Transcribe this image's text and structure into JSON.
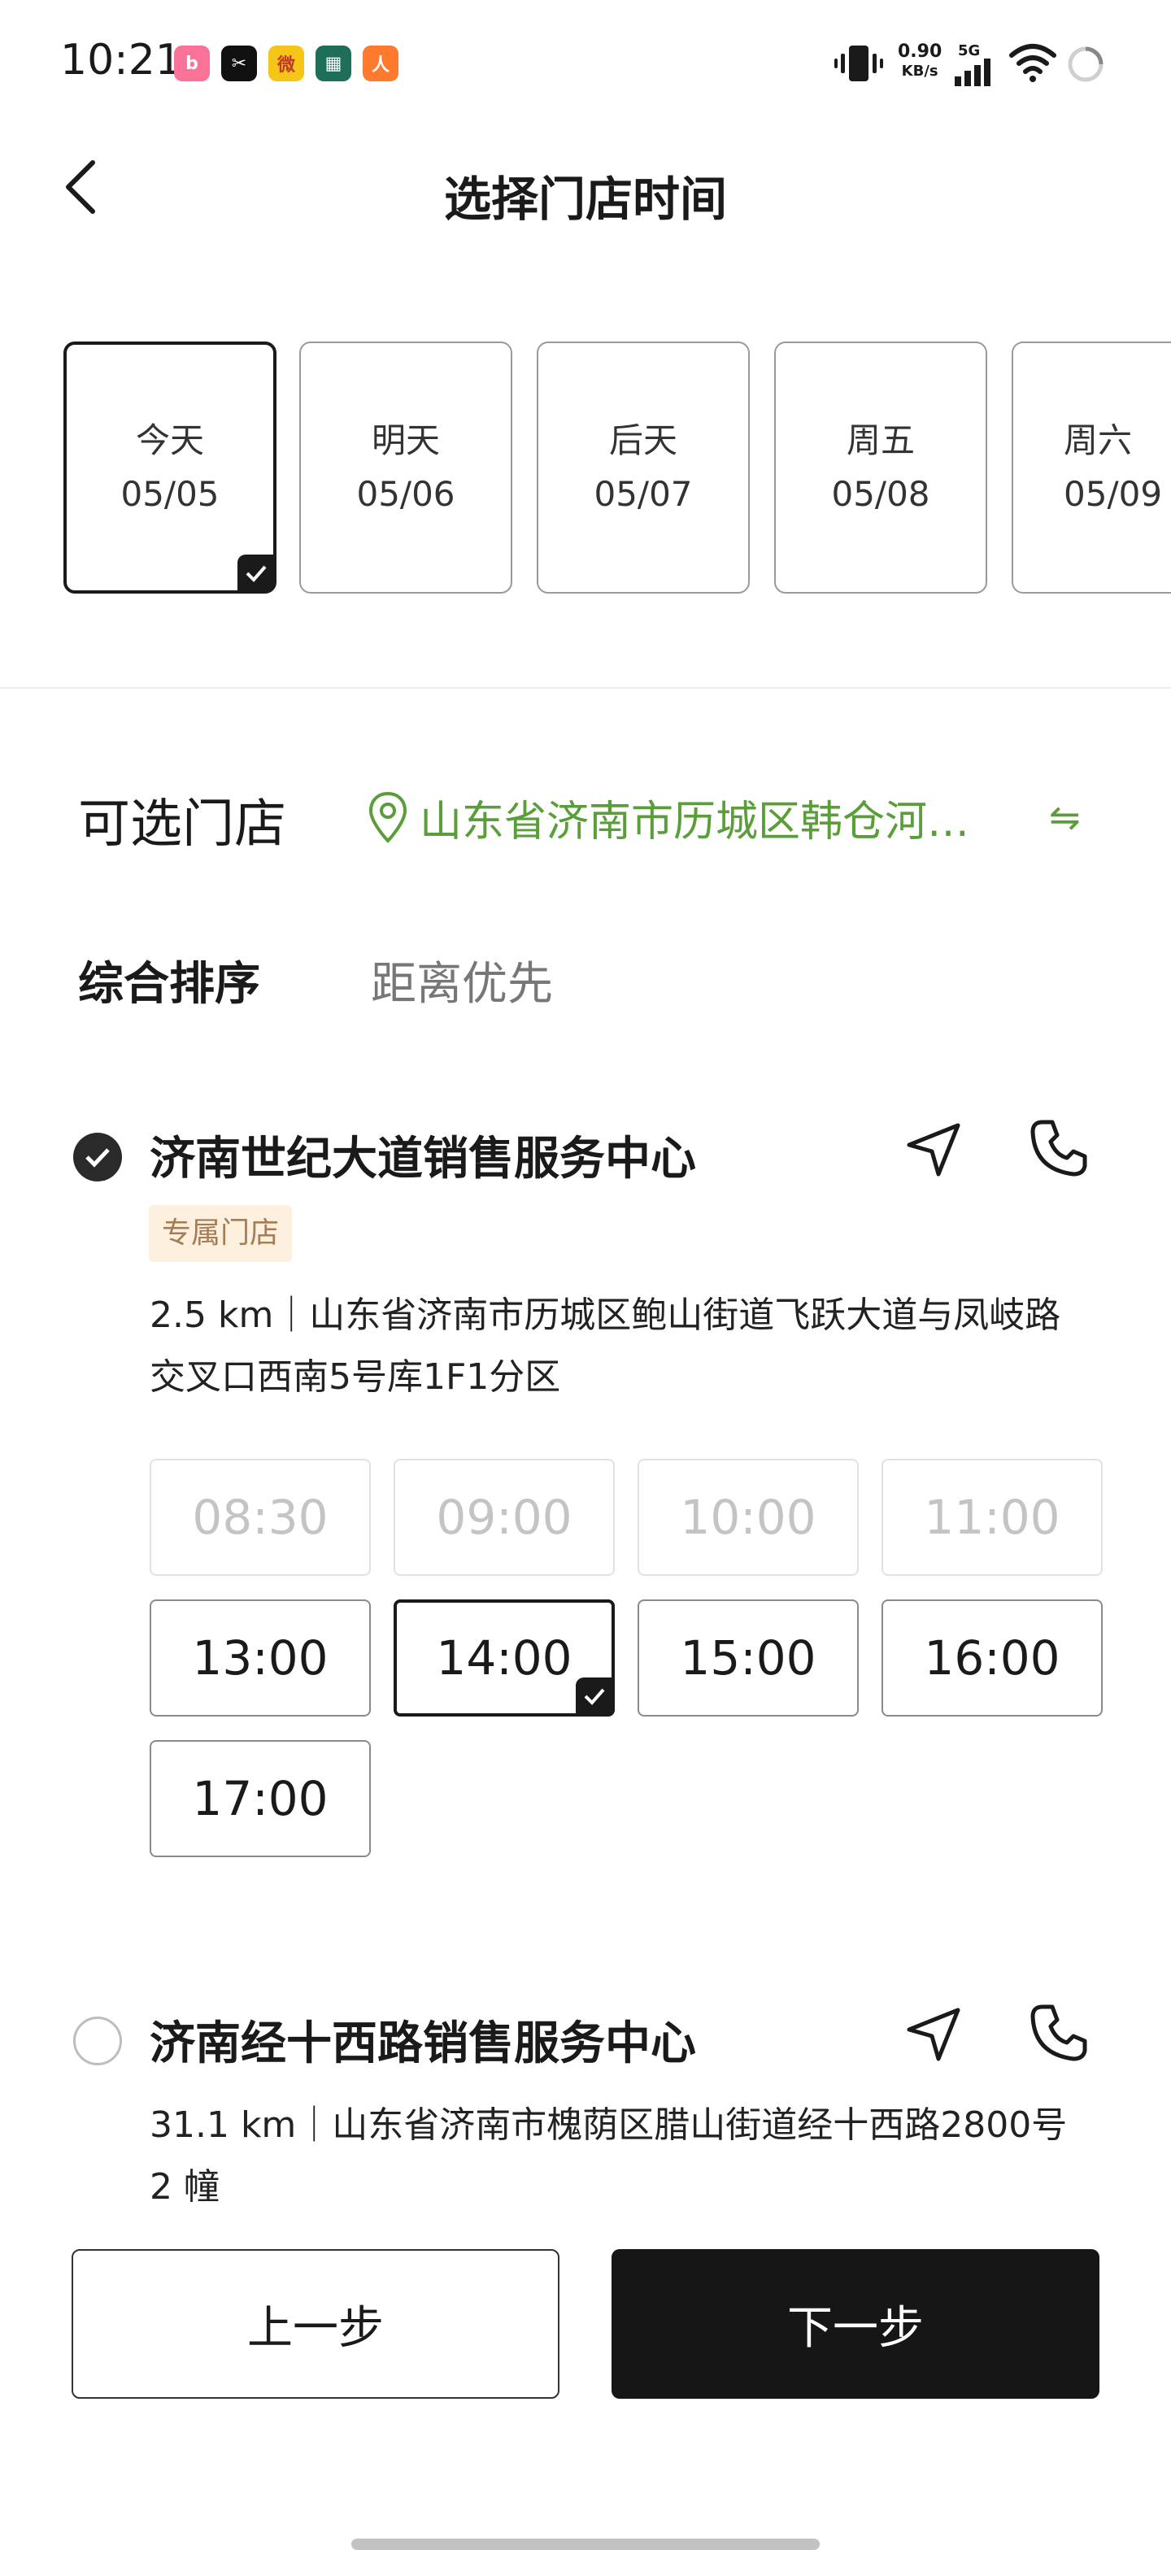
{
  "status_bar": {
    "time": "10:21",
    "apps": [
      {
        "icon": "bilibili-icon",
        "glyph": "b",
        "color": "#fb7299"
      },
      {
        "icon": "capcut-icon",
        "glyph": "✂",
        "color": "#111111"
      },
      {
        "icon": "weibo-icon",
        "glyph": "微",
        "color": "#f5c518"
      },
      {
        "icon": "game-app-icon",
        "glyph": "▦",
        "color": "#1f6e5a"
      },
      {
        "icon": "run-app-icon",
        "glyph": "人",
        "color": "#ff7a2f"
      }
    ],
    "net_speed": "0.90",
    "net_unit": "KB/s",
    "network": "5G",
    "icons": [
      "vibrate-icon",
      "signal-icon",
      "wifi-icon",
      "loading-icon"
    ]
  },
  "header": {
    "title": "选择门店时间",
    "back_icon": "back-chevron-icon"
  },
  "dates": [
    {
      "day": "今天",
      "date": "05/05",
      "selected": true
    },
    {
      "day": "明天",
      "date": "05/06",
      "selected": false
    },
    {
      "day": "后天",
      "date": "05/07",
      "selected": false
    },
    {
      "day": "周五",
      "date": "05/08",
      "selected": false
    },
    {
      "day": "周六",
      "date": "05/09",
      "selected": false
    }
  ],
  "stores_section": {
    "title": "可选门店",
    "location": "山东省济南市历城区韩仓河…",
    "location_icon": "location-pin-icon",
    "switch_icon": "swap-arrows-icon",
    "accent": "#5a9e3a"
  },
  "sort_options": [
    "综合排序",
    "距离优先"
  ],
  "stores": [
    {
      "name": "济南世纪大道销售服务中心",
      "selected": true,
      "badge": "专属门店",
      "address_line1": "2.5 km｜山东省济南市历城区鲍山街道飞跃大道与凤岐路",
      "address_line2": "交叉口西南5号库1F1分区",
      "slots": [
        {
          "time": "08:30",
          "state": "disabled"
        },
        {
          "time": "09:00",
          "state": "disabled"
        },
        {
          "time": "10:00",
          "state": "disabled"
        },
        {
          "time": "11:00",
          "state": "disabled"
        },
        {
          "time": "13:00",
          "state": "available"
        },
        {
          "time": "14:00",
          "state": "selected"
        },
        {
          "time": "15:00",
          "state": "available"
        },
        {
          "time": "16:00",
          "state": "available"
        },
        {
          "time": "17:00",
          "state": "available"
        }
      ]
    },
    {
      "name": "济南经十西路销售服务中心",
      "selected": false,
      "address_line1": "31.1 km｜山东省济南市槐荫区腊山街道经十西路2800号",
      "address_line2": "2 幢"
    }
  ],
  "footer": {
    "prev": "上一步",
    "next": "下一步"
  }
}
